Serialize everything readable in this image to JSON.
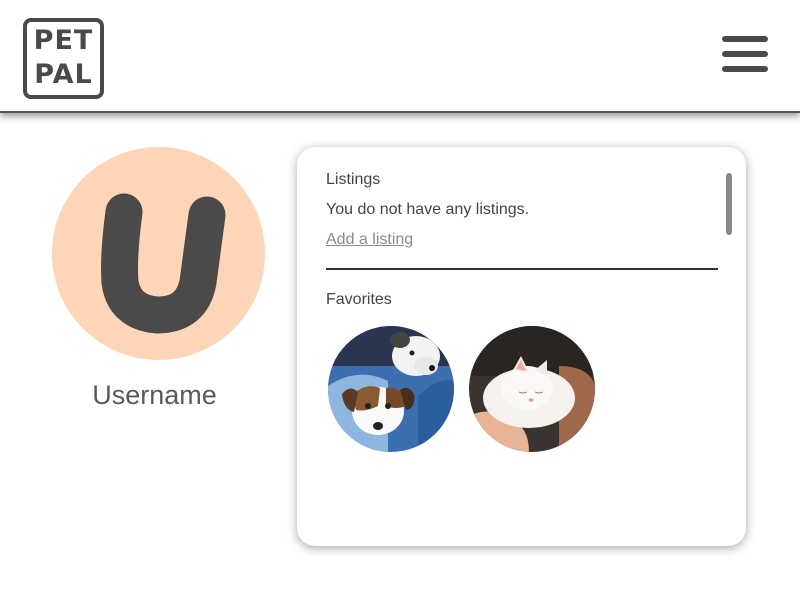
{
  "app": {
    "logo_line1": "PET",
    "logo_line2": "PAL"
  },
  "profile": {
    "avatar_letter": "U",
    "username": "Username"
  },
  "listings": {
    "title": "Listings",
    "empty_message": "You do not have any listings.",
    "add_link": "Add a listing"
  },
  "favorites": {
    "title": "Favorites",
    "items": [
      {
        "name": "dogs-photo"
      },
      {
        "name": "kitten-photo"
      }
    ]
  },
  "colors": {
    "avatar_bg": "#ffd5b8",
    "dark": "#4a4a4a"
  }
}
